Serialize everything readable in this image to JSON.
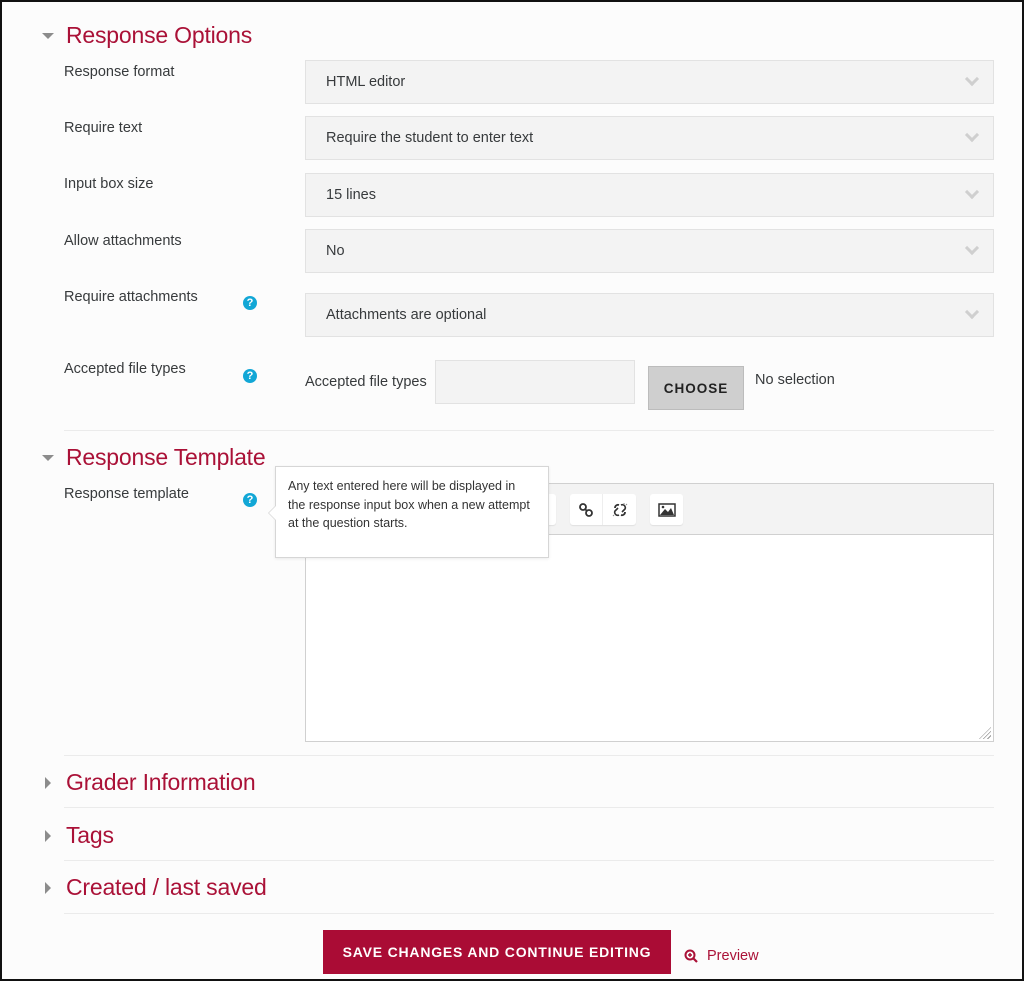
{
  "sections": {
    "response_options": {
      "title": "Response Options",
      "expanded": true,
      "fields": [
        {
          "label": "Response format",
          "value": "HTML editor",
          "help": false
        },
        {
          "label": "Require text",
          "value": "Require the student to enter text",
          "help": false
        },
        {
          "label": "Input box size",
          "value": "15 lines",
          "help": false
        },
        {
          "label": "Allow attachments",
          "value": "No",
          "help": false
        },
        {
          "label": "Require attachments",
          "value": "Attachments are optional",
          "help": true
        }
      ],
      "accepted_file_types": {
        "label": "Accepted file types",
        "inner_label": "Accepted file types",
        "input_value": "",
        "choose_label": "CHOOSE",
        "selection_text": "No selection",
        "help": true
      }
    },
    "response_template": {
      "title": "Response Template",
      "expanded": true,
      "field_label": "Response template",
      "help_tooltip": "Any text entered here will be displayed in the response input box when a new attempt at the question starts.",
      "editor_content": "",
      "toolbar_icons": [
        "list-icon",
        "link-icon",
        "unlink-icon",
        "image-icon"
      ]
    },
    "grader_information": {
      "title": "Grader Information",
      "expanded": false
    },
    "tags": {
      "title": "Tags",
      "expanded": false
    },
    "created_last_saved": {
      "title": "Created / last saved",
      "expanded": false
    }
  },
  "actions": {
    "save_label": "SAVE CHANGES AND CONTINUE EDITING",
    "preview_label": "Preview"
  },
  "colors": {
    "accent": "#aa1137",
    "help_icon": "#12a7d6",
    "button_bg": "#aa0c35"
  }
}
